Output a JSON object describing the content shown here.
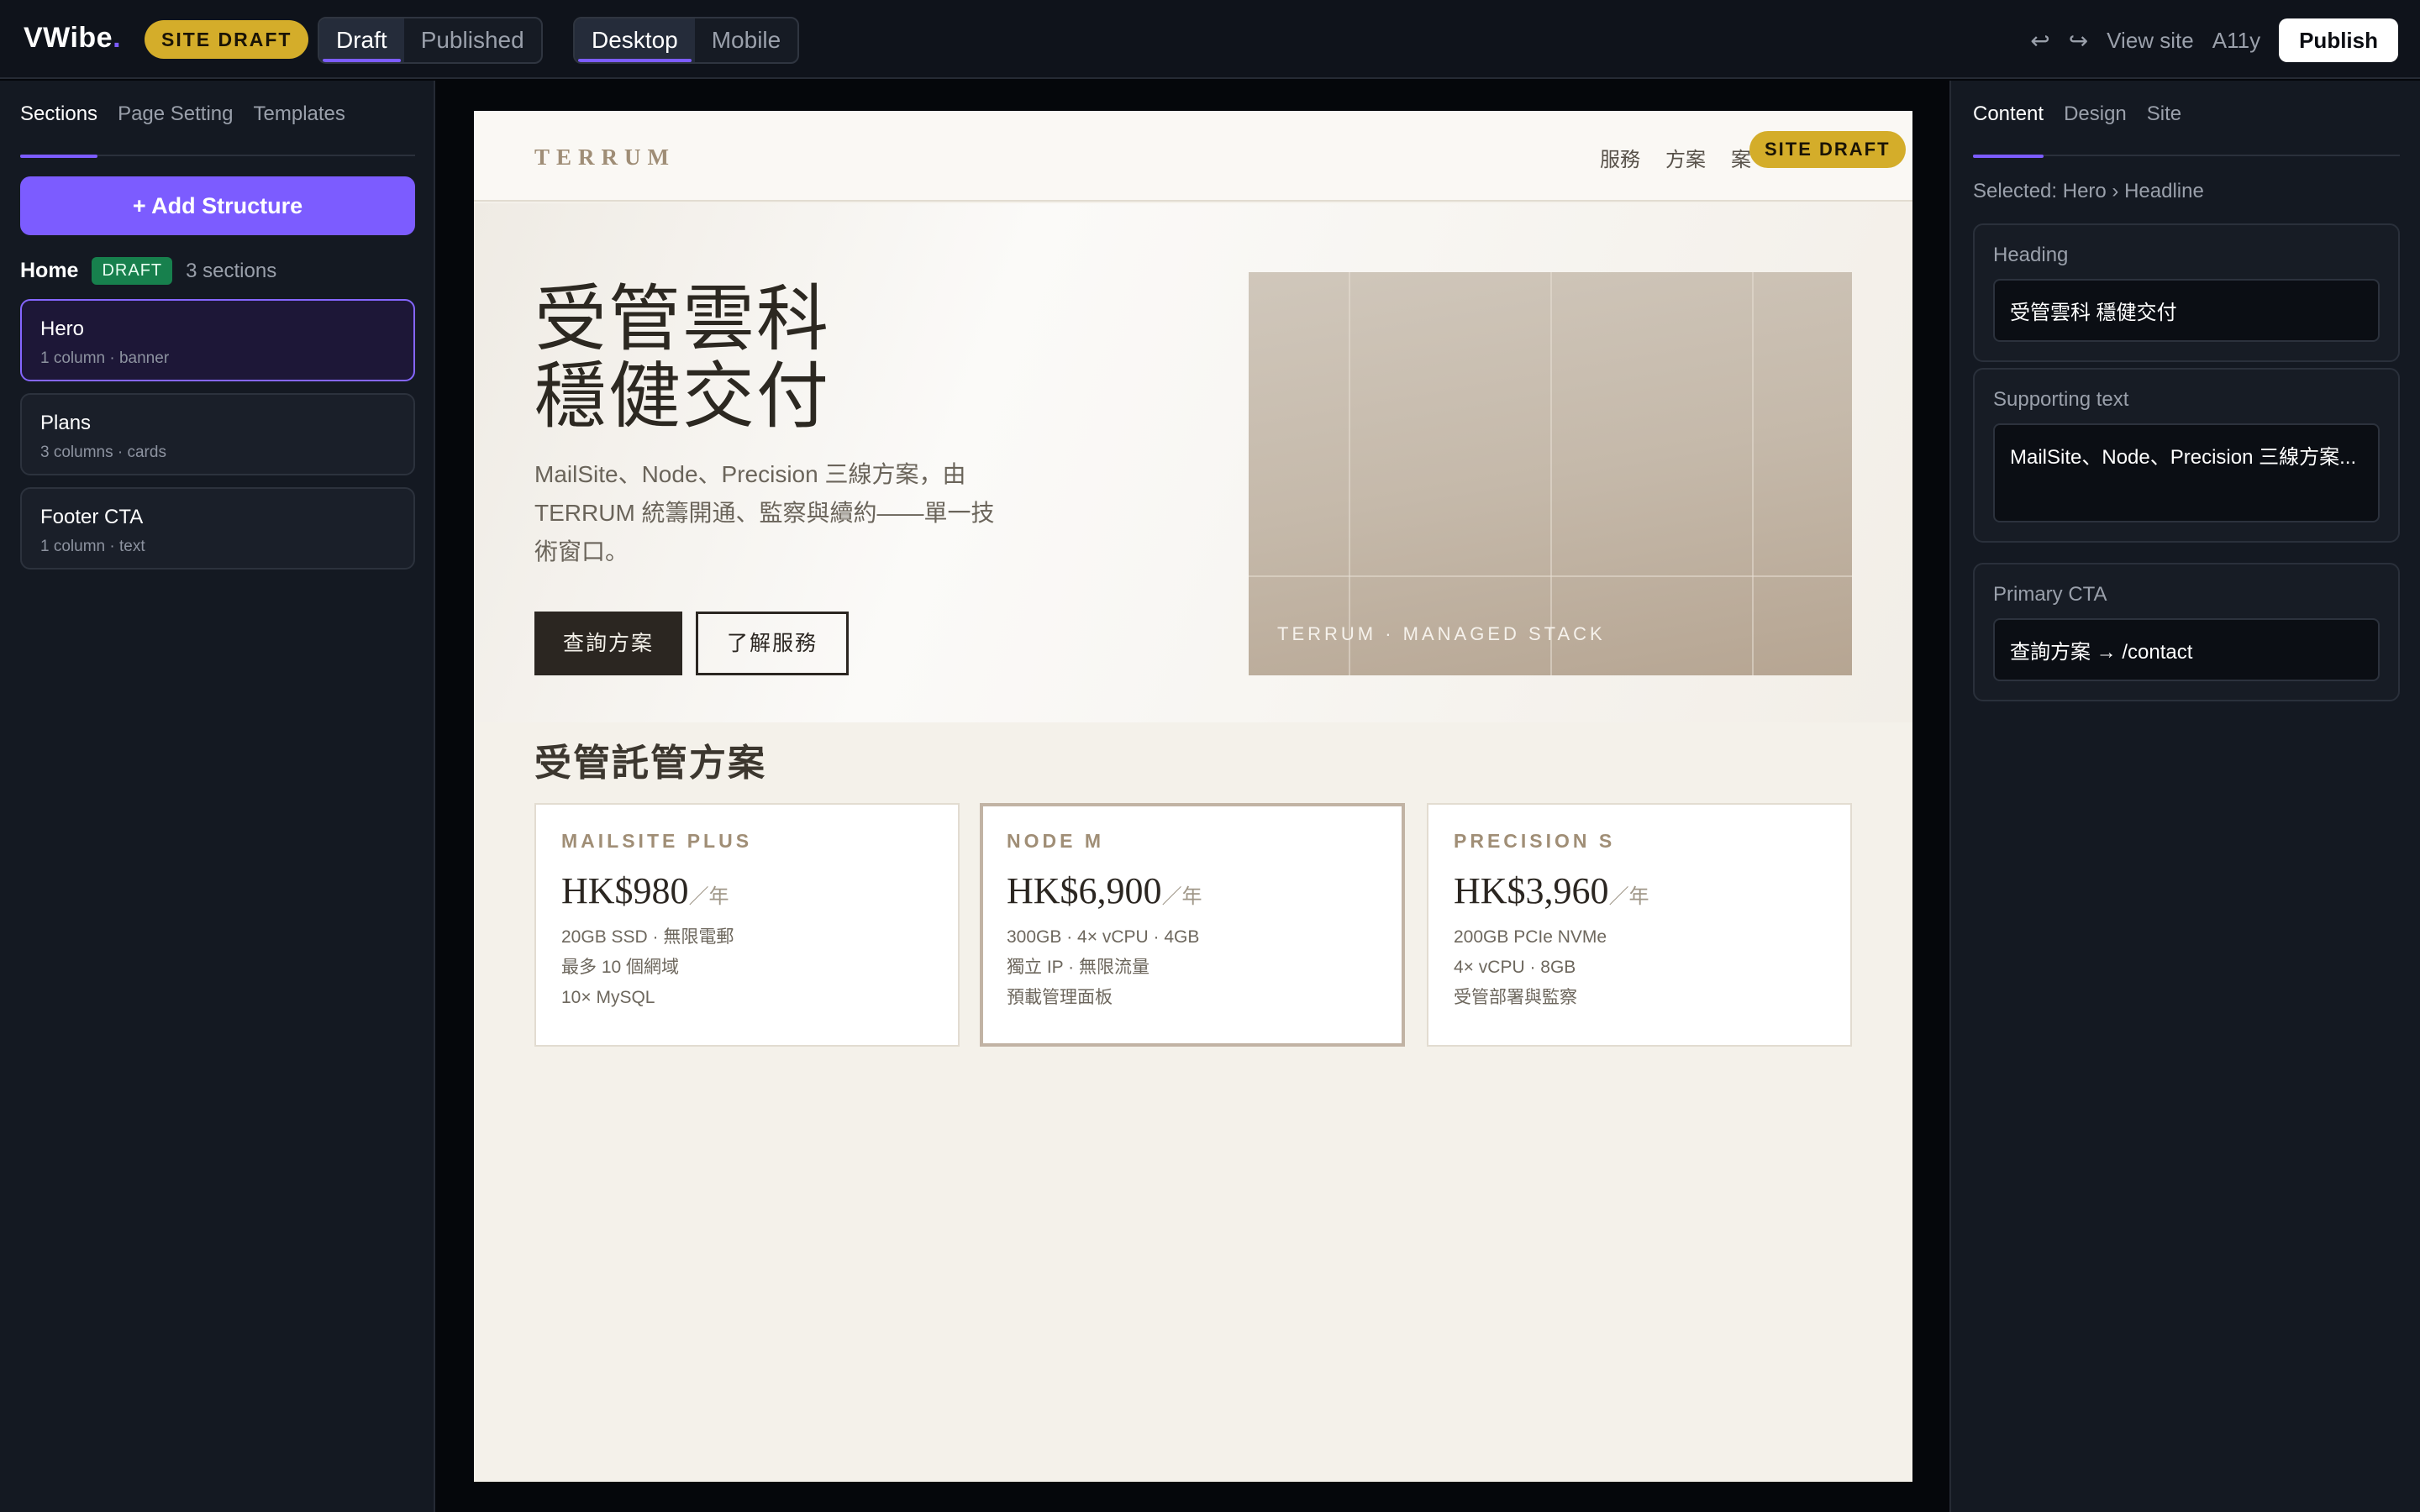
{
  "app": {
    "logo": "VWibe",
    "logo_dot": ".",
    "site_badge": "SITE DRAFT",
    "mode_tabs": [
      "Draft",
      "Published"
    ],
    "view_tabs": [
      "Desktop",
      "Mobile"
    ],
    "undo_icon": "undo-icon",
    "redo_icon": "redo-icon",
    "view_site": "View site",
    "a11y": "A11y",
    "publish": "Publish",
    "accent_color": "#7c5cff",
    "badge_color": "#d4ad2a"
  },
  "left": {
    "tabs": [
      "Sections",
      "Page Setting",
      "Templates"
    ],
    "add_label": "+ Add Structure",
    "page": {
      "name": "Home",
      "status": "DRAFT",
      "count": "3 sections"
    },
    "sections": [
      {
        "title": "Hero",
        "sub": "1 column · banner"
      },
      {
        "title": "Plans",
        "sub": "3 columns · cards"
      },
      {
        "title": "Footer CTA",
        "sub": "1 column · text"
      }
    ]
  },
  "right": {
    "tabs": [
      "Content",
      "Design",
      "Site"
    ],
    "selected": "Selected: Hero › Headline",
    "fields": [
      {
        "label": "Heading",
        "value": "受管雲科 穩健交付"
      },
      {
        "label": "Supporting text",
        "value": "MailSite、Node、Precision 三線方案..."
      },
      {
        "label": "Primary CTA",
        "value": "查詢方案 → /contact"
      }
    ]
  },
  "site": {
    "brand": "TERRUM",
    "nav": [
      "服務",
      "方案",
      "案"
    ],
    "badge": "SITE DRAFT",
    "hero": {
      "title_lines": [
        "受管雲科",
        "穩健交付"
      ],
      "sub": "MailSite、Node、Precision 三線方案，由 TERRUM 統籌開通、監察與續約——單一技術窗口。",
      "cta_primary": "查詢方案",
      "cta_secondary": "了解服務",
      "image_caption": "TERRUM · MANAGED STACK"
    },
    "plans_title": "受管託管方案",
    "plans": [
      {
        "name": "MAILSITE PLUS",
        "price": "HK$980",
        "per": "／年",
        "lines": [
          "20GB SSD · 無限電郵",
          "最多 10 個網域",
          "10× MySQL"
        ]
      },
      {
        "name": "NODE M",
        "price": "HK$6,900",
        "per": "／年",
        "lines": [
          "300GB · 4× vCPU · 4GB",
          "獨立 IP · 無限流量",
          "預載管理面板"
        ]
      },
      {
        "name": "PRECISION S",
        "price": "HK$3,960",
        "per": "／年",
        "lines": [
          "200GB PCIe NVMe",
          "4× vCPU · 8GB",
          "受管部署與監察"
        ]
      }
    ]
  }
}
